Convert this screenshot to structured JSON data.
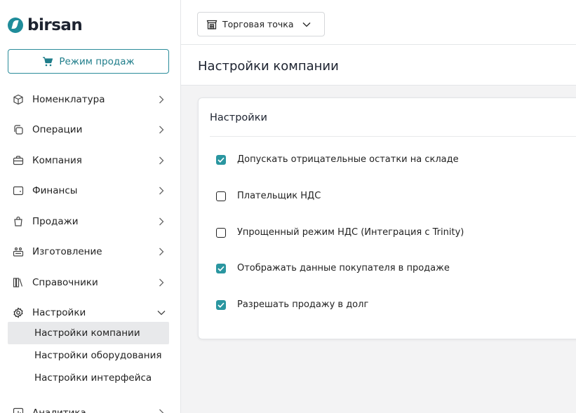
{
  "logo": {
    "text": "birsan"
  },
  "sale_mode": {
    "label": "Режим продаж"
  },
  "nav": {
    "items": [
      {
        "label": "Номенклатура"
      },
      {
        "label": "Операции"
      },
      {
        "label": "Компания"
      },
      {
        "label": "Финансы"
      },
      {
        "label": "Продажи"
      },
      {
        "label": "Изготовление"
      },
      {
        "label": "Справочники"
      },
      {
        "label": "Настройки"
      }
    ],
    "settings_sub": [
      {
        "label": "Настройки компании"
      },
      {
        "label": "Настройки оборудования"
      },
      {
        "label": "Настройки интерфейса"
      }
    ],
    "analytics": {
      "label": "Аналитика"
    }
  },
  "topbar": {
    "store_label": "Торговая точка"
  },
  "page": {
    "title": "Настройки компании"
  },
  "card": {
    "title": "Настройки",
    "options": [
      {
        "label": "Допускать отрицательные остатки на складе",
        "checked": true
      },
      {
        "label": "Плательщик НДС",
        "checked": false
      },
      {
        "label": "Упрощенный режим НДС (Интеграция с Trinity)",
        "checked": false
      },
      {
        "label": "Отображать данные покупателя в продаже",
        "checked": true
      },
      {
        "label": "Разрешать продажу в долг",
        "checked": true
      }
    ]
  },
  "colors": {
    "accent": "#2a96a0",
    "active_bg": "#e8e9eb"
  }
}
